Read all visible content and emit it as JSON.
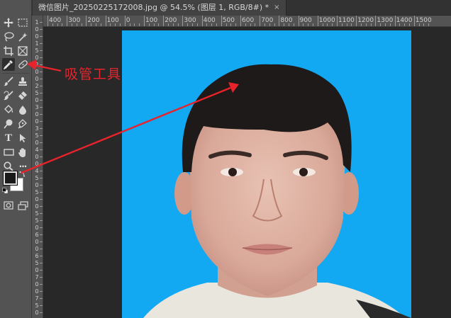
{
  "document": {
    "tab_title": "微信图片_20250225172008.jpg @ 54.5% (图层 1, RGB/8#) *",
    "close_glyph": "×"
  },
  "ruler": {
    "top_labels": [
      "400",
      "300",
      "200",
      "100",
      "0",
      "100",
      "200",
      "300",
      "400",
      "500",
      "600",
      "700",
      "800",
      "900",
      "1000",
      "1100",
      "1200",
      "1300",
      "1400",
      "1500"
    ],
    "left_labels": [
      "1",
      "0",
      "0",
      "1",
      "5",
      "0",
      "2",
      "0",
      "0",
      "2",
      "5",
      "0",
      "3",
      "0",
      "0",
      "3",
      "5",
      "0",
      "4",
      "0",
      "0",
      "4",
      "5",
      "0",
      "5",
      "0",
      "0",
      "5",
      "5",
      "0",
      "6",
      "0",
      "0",
      "6",
      "5",
      "0",
      "7",
      "0",
      "0",
      "7",
      "5",
      "0"
    ]
  },
  "toolbar": {
    "tools": [
      {
        "name": "move-tool",
        "icon": "move-icon"
      },
      {
        "name": "marquee-tool",
        "icon": "marquee-icon"
      },
      {
        "name": "lasso-tool",
        "icon": "lasso-icon"
      },
      {
        "name": "magic-wand-tool",
        "icon": "magic-wand-icon"
      },
      {
        "name": "crop-tool",
        "icon": "crop-icon"
      },
      {
        "name": "frame-tool",
        "icon": "frame-icon"
      },
      {
        "name": "eyedropper-tool",
        "icon": "eyedropper-icon",
        "active": true
      },
      {
        "name": "healing-brush-tool",
        "icon": "bandage-icon"
      },
      {
        "name": "brush-tool",
        "icon": "brush-icon"
      },
      {
        "name": "clone-stamp-tool",
        "icon": "stamp-icon"
      },
      {
        "name": "history-brush-tool",
        "icon": "history-brush-icon"
      },
      {
        "name": "eraser-tool",
        "icon": "eraser-icon"
      },
      {
        "name": "paint-bucket-tool",
        "icon": "bucket-icon"
      },
      {
        "name": "blur-tool",
        "icon": "blur-drop-icon"
      },
      {
        "name": "dodge-tool",
        "icon": "dodge-icon"
      },
      {
        "name": "pen-tool",
        "icon": "pen-icon"
      },
      {
        "name": "type-tool",
        "icon": "type-icon"
      },
      {
        "name": "path-selection-tool",
        "icon": "arrow-icon"
      },
      {
        "name": "rectangle-tool",
        "icon": "rectangle-icon"
      },
      {
        "name": "hand-tool",
        "icon": "hand-icon"
      },
      {
        "name": "zoom-tool",
        "icon": "zoom-icon"
      },
      {
        "name": "more-tools",
        "icon": "ellipsis-icon"
      }
    ],
    "type_glyph": "T",
    "more_glyph": "···",
    "foreground_color": "#1a1a1a",
    "background_color": "#ffffff"
  },
  "colors": {
    "photo_background": "#12a8f2",
    "annotation": "#e8232b"
  },
  "annotation": {
    "label": "吸管工具"
  }
}
